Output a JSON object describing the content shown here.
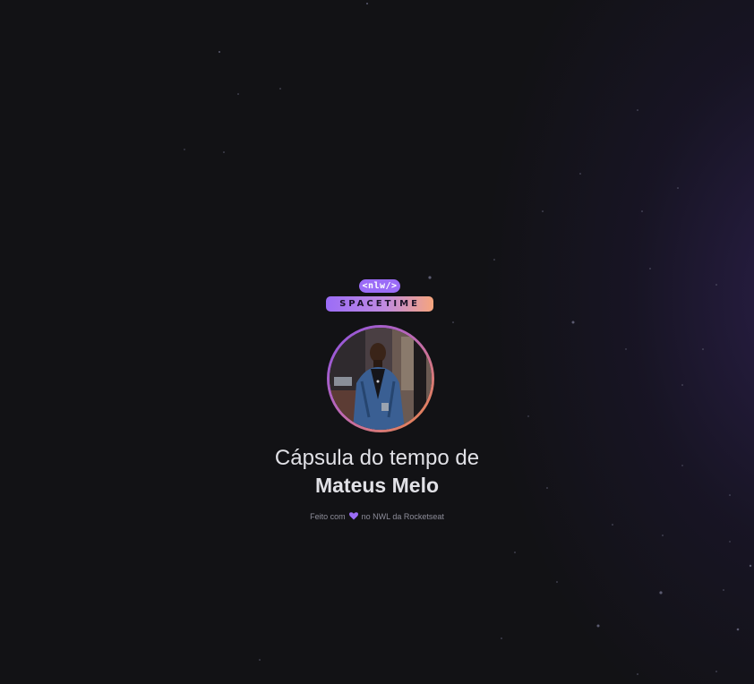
{
  "logo": {
    "badge_text": "<nlw/>",
    "wordmark": "SPACETIME"
  },
  "capsule": {
    "title": "Cápsula do tempo de",
    "owner_name": "Mateus Melo"
  },
  "footer": {
    "prefix": "Feito com",
    "suffix": "no NWL da Rocketseat"
  },
  "icons": {
    "heart": "heart-icon"
  },
  "colors": {
    "background": "#121215",
    "accent_purple": "#9b6cf7",
    "accent_orange": "#f0893e",
    "text_primary": "#e1e1e6",
    "text_muted": "#8d8d99"
  }
}
